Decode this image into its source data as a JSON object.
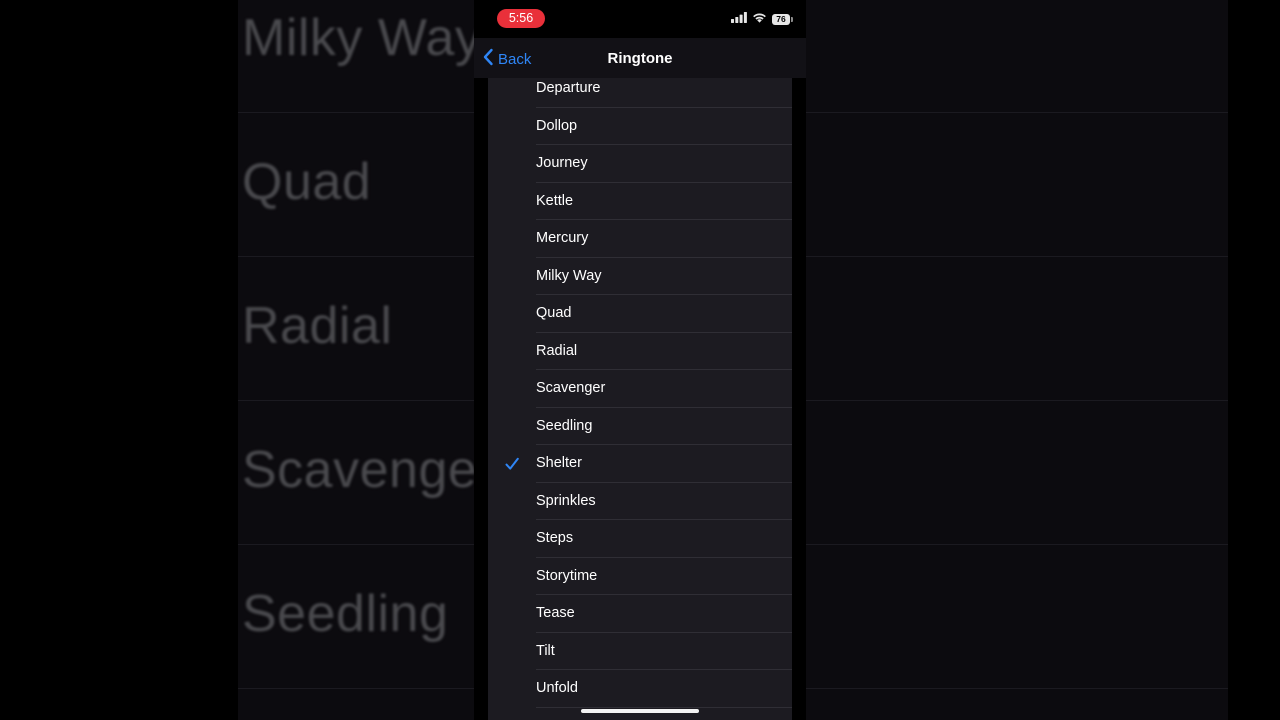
{
  "background": {
    "labels": [
      "Milky Way",
      "Quad",
      "Radial",
      "Scavenger",
      "Seedling"
    ]
  },
  "statusbar": {
    "time": "5:56",
    "battery": "76",
    "time_pill_color": "#e9303a"
  },
  "navbar": {
    "back_label": "Back",
    "title": "Ringtone",
    "accent": "#2f86f6"
  },
  "ringtones": {
    "items": [
      {
        "label": "Departure",
        "selected": false
      },
      {
        "label": "Dollop",
        "selected": false
      },
      {
        "label": "Journey",
        "selected": false
      },
      {
        "label": "Kettle",
        "selected": false
      },
      {
        "label": "Mercury",
        "selected": false
      },
      {
        "label": "Milky Way",
        "selected": false
      },
      {
        "label": "Quad",
        "selected": false
      },
      {
        "label": "Radial",
        "selected": false
      },
      {
        "label": "Scavenger",
        "selected": false
      },
      {
        "label": "Seedling",
        "selected": false
      },
      {
        "label": "Shelter",
        "selected": true
      },
      {
        "label": "Sprinkles",
        "selected": false
      },
      {
        "label": "Steps",
        "selected": false
      },
      {
        "label": "Storytime",
        "selected": false
      },
      {
        "label": "Tease",
        "selected": false
      },
      {
        "label": "Tilt",
        "selected": false
      },
      {
        "label": "Unfold",
        "selected": false
      }
    ]
  },
  "icons": {
    "back": "chevron-left-icon",
    "selected": "checkmark-icon",
    "signal": "cellular-signal-icon",
    "wifi": "wifi-icon",
    "battery": "battery-icon"
  }
}
